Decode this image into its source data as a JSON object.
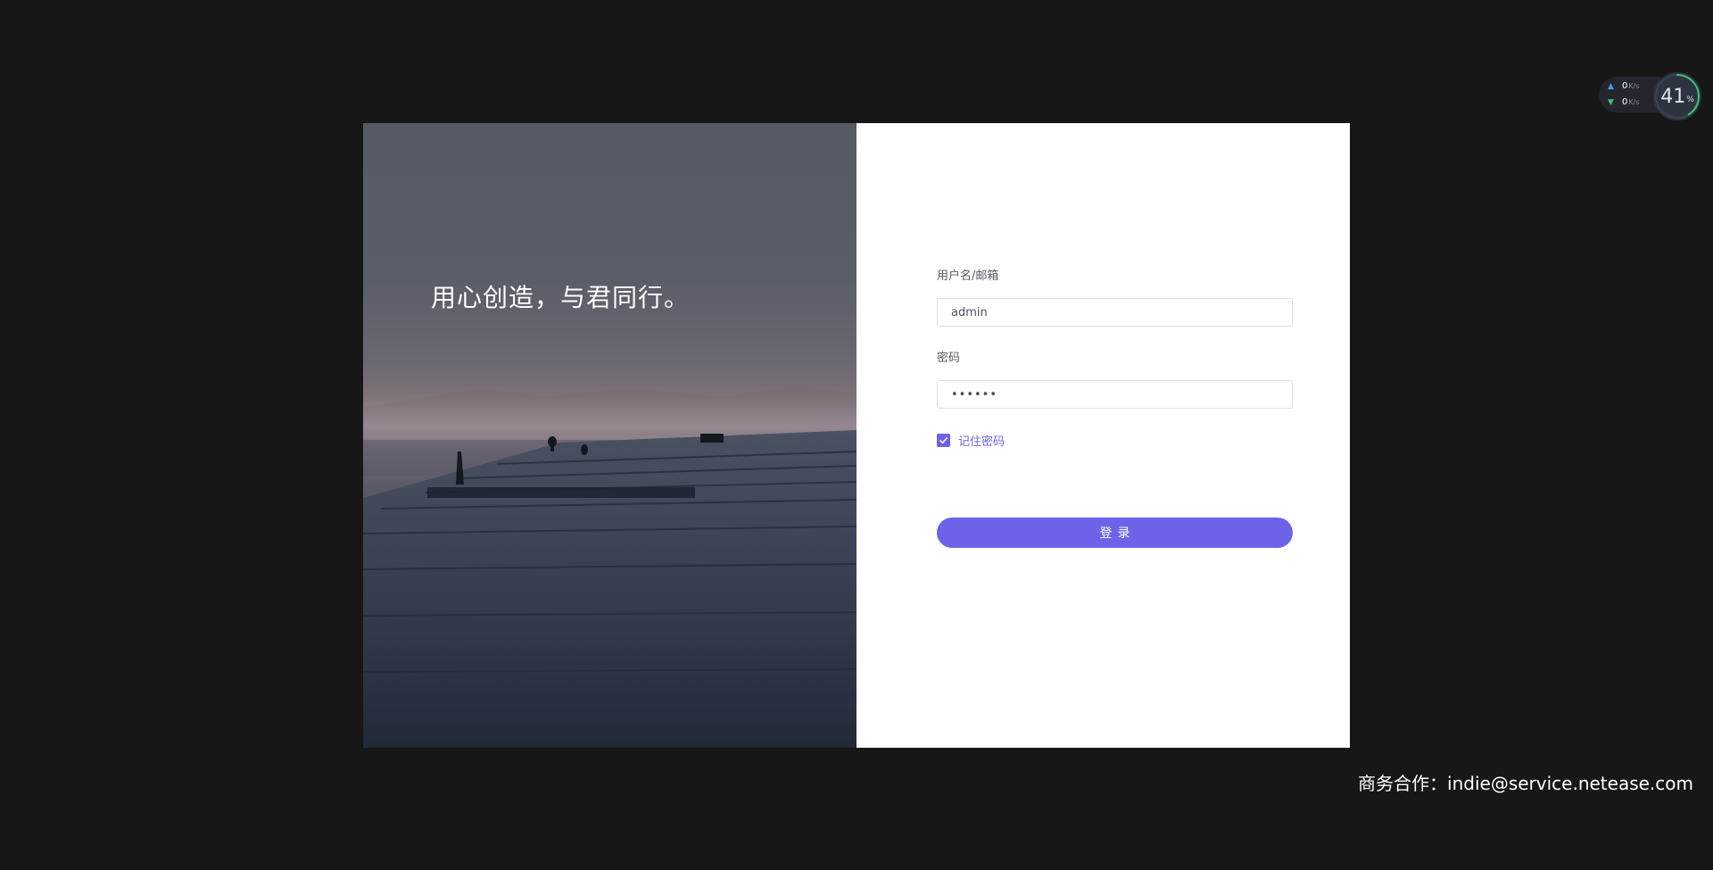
{
  "hero": {
    "slogan": "用心创造，与君同行。"
  },
  "login_form": {
    "username_label": "用户名/邮箱",
    "username_value": "admin",
    "password_label": "密码",
    "password_value": "••••••",
    "remember_label": "记住密码",
    "remember_checked": true,
    "login_button": "登录"
  },
  "footer": {
    "contact": "商务合作：indie@service.netease.com"
  },
  "net_widget": {
    "upload_value": "0",
    "upload_unit": "K/s",
    "download_value": "0",
    "download_unit": "K/s",
    "usage_value": "41",
    "usage_unit": "%",
    "usage_fraction": 0.41
  },
  "colors": {
    "accent": "#6c63e8",
    "page_background": "#171717",
    "upload_arrow": "#3b9dff",
    "download_arrow": "#3cc46e"
  }
}
